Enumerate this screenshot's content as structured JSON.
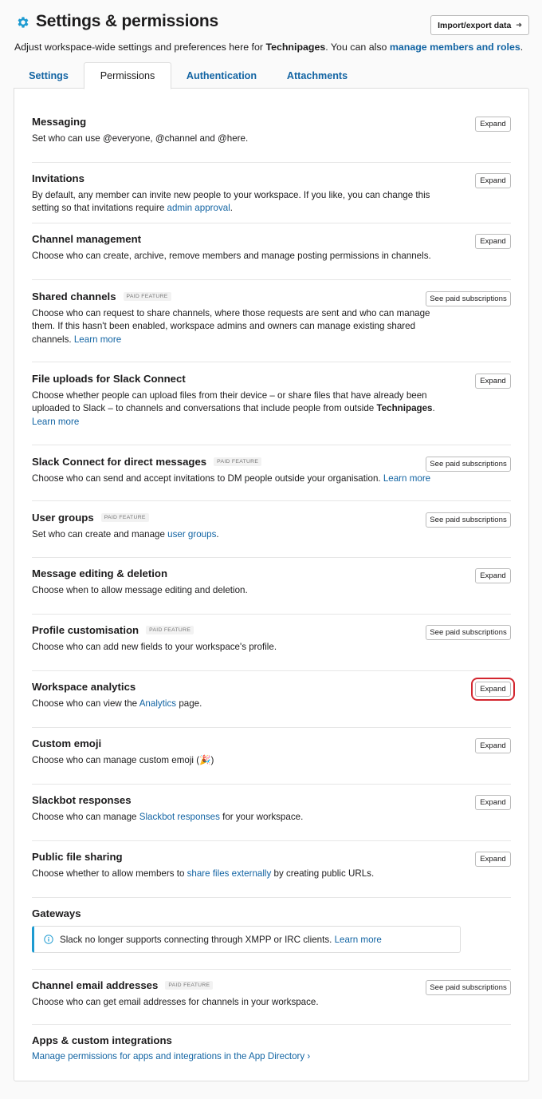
{
  "header": {
    "title": "Settings & permissions",
    "import_button": "Import/export data",
    "import_arrow": "➜"
  },
  "subtitle": {
    "prefix": "Adjust workspace-wide settings and preferences here for ",
    "workspace": "Technipages",
    "middle": ". You can also ",
    "link": "manage members and roles",
    "suffix": "."
  },
  "tabs": [
    {
      "label": "Settings"
    },
    {
      "label": "Permissions"
    },
    {
      "label": "Authentication"
    },
    {
      "label": "Attachments"
    }
  ],
  "labels": {
    "expand": "Expand",
    "see_paid": "See paid subscriptions",
    "paid_feature": "PAID FEATURE"
  },
  "sections": {
    "messaging": {
      "title": "Messaging",
      "desc": "Set who can use @everyone, @channel and @here."
    },
    "invitations": {
      "title": "Invitations",
      "desc": "By default, any member can invite new people to your workspace. If you like, you can change this setting so that invitations require ",
      "link": "admin approval",
      "desc_end": "."
    },
    "channel_management": {
      "title": "Channel management",
      "desc": "Choose who can create, archive, remove members and manage posting permissions in channels."
    },
    "shared_channels": {
      "title": "Shared channels",
      "desc": "Choose who can request to share channels, where those requests are sent and who can manage them. If this hasn't been enabled, workspace admins and owners can manage existing shared channels. ",
      "link": "Learn more"
    },
    "file_uploads": {
      "title": "File uploads for Slack Connect",
      "desc": "Choose whether people can upload files from their device – or share files that have already been uploaded to Slack – to channels and conversations that include people from outside ",
      "bold": "Technipages",
      "desc_end": ".",
      "link": "Learn more"
    },
    "slack_connect_dm": {
      "title": "Slack Connect for direct messages",
      "desc": "Choose who can send and accept invitations to DM people outside your organisation. ",
      "link": "Learn more"
    },
    "user_groups": {
      "title": "User groups",
      "desc": "Set who can create and manage ",
      "link": "user groups",
      "desc_end": "."
    },
    "message_editing": {
      "title": "Message editing & deletion",
      "desc": "Choose when to allow message editing and deletion."
    },
    "profile_customisation": {
      "title": "Profile customisation",
      "desc": "Choose who can add new fields to your workspace's profile."
    },
    "workspace_analytics": {
      "title": "Workspace analytics",
      "desc": "Choose who can view the ",
      "link": "Analytics",
      "desc_end": " page."
    },
    "custom_emoji": {
      "title": "Custom emoji",
      "desc": "Choose who can manage custom emoji (",
      "emoji": "🎉",
      "desc_end": ")"
    },
    "slackbot_responses": {
      "title": "Slackbot responses",
      "desc": "Choose who can manage ",
      "link": "Slackbot responses",
      "desc_end": " for your workspace."
    },
    "public_file_sharing": {
      "title": "Public file sharing",
      "desc": "Choose whether to allow members to ",
      "link": "share files externally",
      "desc_end": " by creating public URLs."
    },
    "gateways": {
      "title": "Gateways",
      "info": "Slack no longer supports connecting through XMPP or IRC clients. ",
      "link": "Learn more"
    },
    "channel_email": {
      "title": "Channel email addresses",
      "desc": "Choose who can get email addresses for channels in your workspace."
    },
    "apps": {
      "title": "Apps & custom integrations",
      "link": "Manage permissions for apps and integrations in the App Directory ›"
    }
  },
  "colors": {
    "link": "#1264a3",
    "highlight": "#d3262f",
    "gear": "#1d9bd1",
    "info_accent": "#1d9bd1"
  }
}
